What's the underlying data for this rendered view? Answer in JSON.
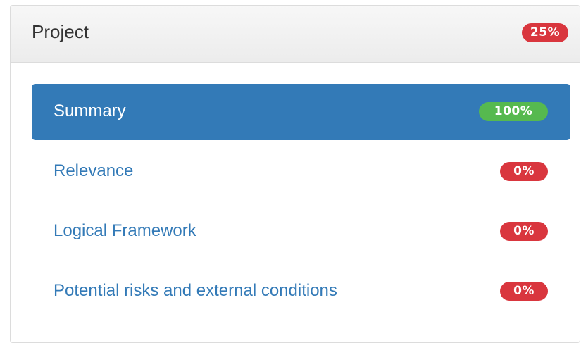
{
  "panel": {
    "title": "Project",
    "progress_label": "25%",
    "progress_color": "#d9363e"
  },
  "nav": {
    "items": [
      {
        "label": "Summary",
        "progress_label": "100%",
        "active": true,
        "badge_color": "#56b94f"
      },
      {
        "label": "Relevance",
        "progress_label": "0%",
        "active": false,
        "badge_color": "#d9363e"
      },
      {
        "label": "Logical Framework",
        "progress_label": "0%",
        "active": false,
        "badge_color": "#d9363e"
      },
      {
        "label": "Potential risks and external conditions",
        "progress_label": "0%",
        "active": false,
        "badge_color": "#d9363e"
      }
    ]
  },
  "colors": {
    "active_background": "#337ab7",
    "link_text": "#337ab7",
    "badge_red": "#d9363e",
    "badge_green": "#56b94f"
  }
}
